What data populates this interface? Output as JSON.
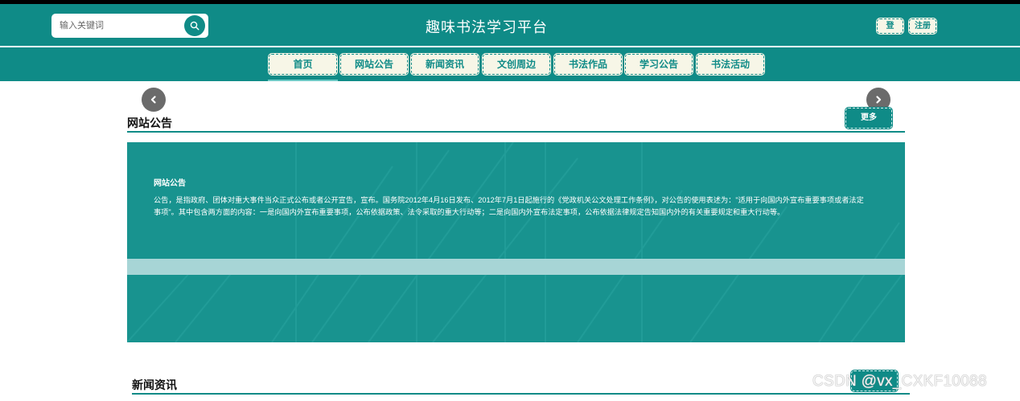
{
  "header": {
    "title": "趣味书法学习平台",
    "search": {
      "placeholder": "输入关键词"
    },
    "login_label": "登录",
    "register_label": "注册"
  },
  "nav": {
    "items": [
      {
        "label": "首页",
        "active": true
      },
      {
        "label": "网站公告"
      },
      {
        "label": "新闻资讯"
      },
      {
        "label": "文创周边"
      },
      {
        "label": "书法作品"
      },
      {
        "label": "学习公告"
      },
      {
        "label": "书法活动"
      }
    ]
  },
  "notice_section": {
    "title": "网站公告",
    "more_label": "更多",
    "card_title": "网站公告",
    "card_body": "公告，是指政府、团体对重大事件当众正式公布或者公开宣告，宣布。国务院2012年4月16日发布、2012年7月1日起施行的《党政机关公文处理工作条例》，对公告的使用表述为：\"适用于向国内外宣布重要事项或者法定事项\"。其中包含两方面的内容：一是向国内外宣布重要事项，公布依据政策、法令采取的重大行动等；二是向国内外宣布法定事项，公布依据法律规定告知国内外的有关重要规定和重大行动等。"
  },
  "news_section": {
    "title": "新闻资讯"
  },
  "watermark": "CSDN @vx_CXKF10088",
  "colors": {
    "primary": "#0f8b87",
    "button_bg": "#f7f6e7",
    "panel": "#18938f"
  },
  "icons": {
    "search": "search-icon",
    "prev": "chevron-left-icon",
    "next": "chevron-right-icon"
  }
}
